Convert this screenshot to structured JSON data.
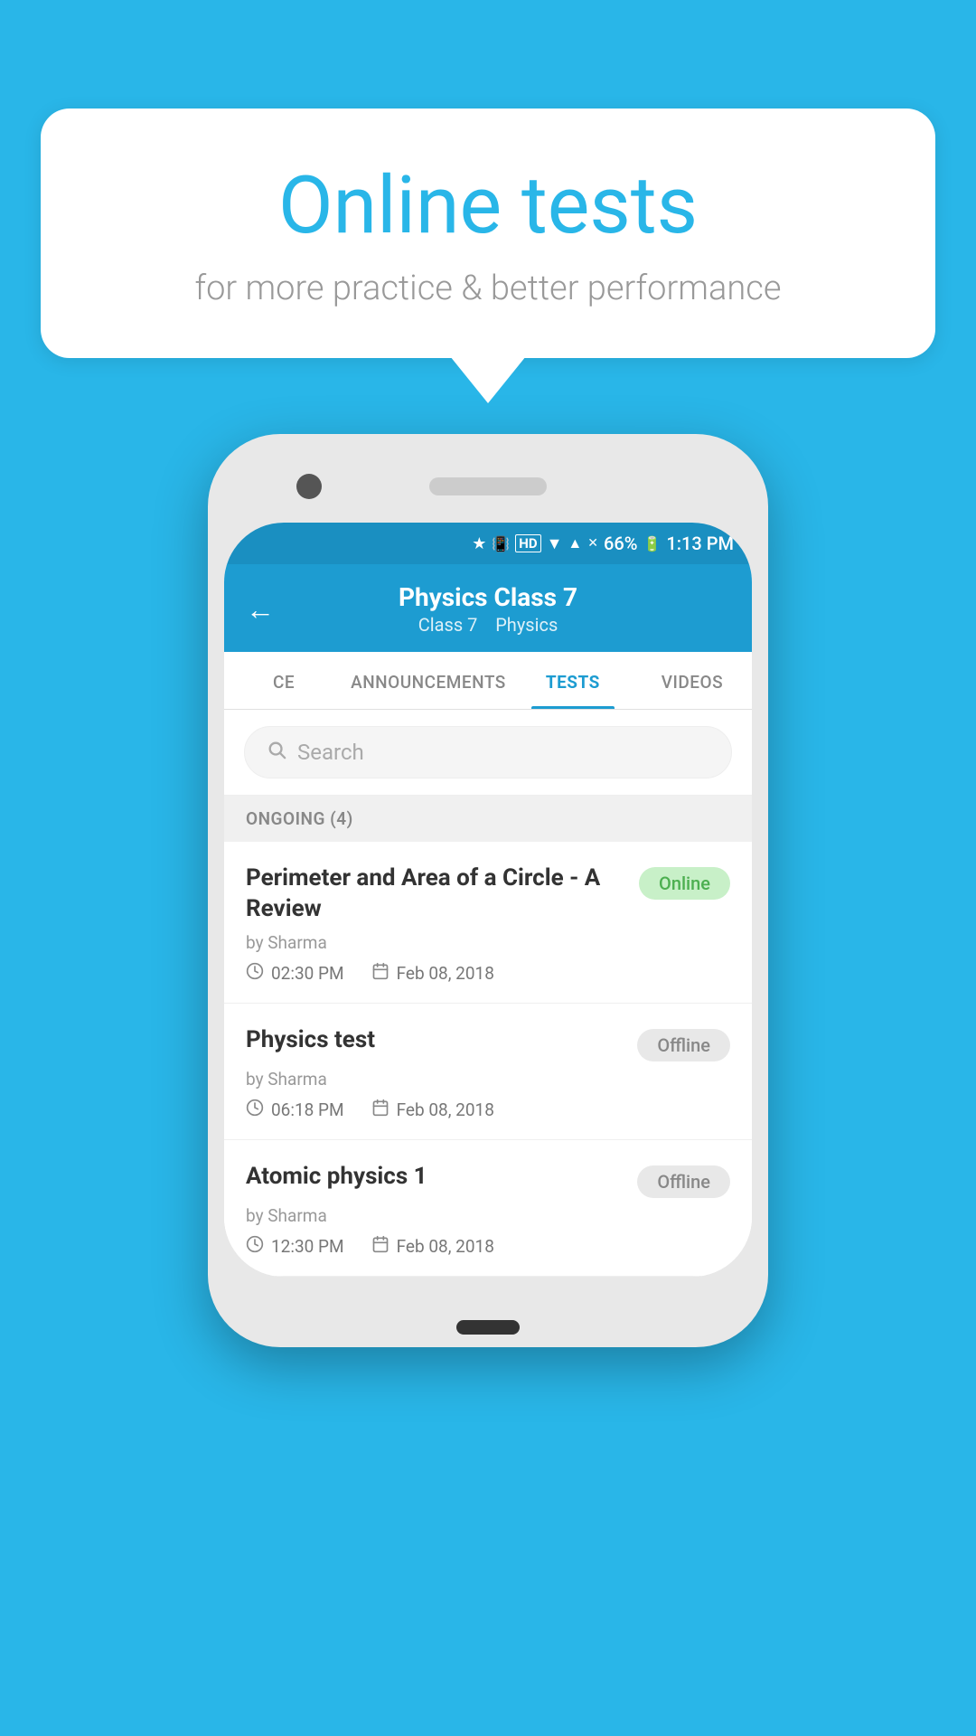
{
  "background_color": "#29b6e8",
  "bubble": {
    "title": "Online tests",
    "subtitle": "for more practice & better performance"
  },
  "status_bar": {
    "time": "1:13 PM",
    "battery": "66%",
    "icons": "* ⬜ HD ▼ ✕ 66%"
  },
  "header": {
    "title": "Physics Class 7",
    "subtitle_class": "Class 7",
    "subtitle_subject": "Physics",
    "back_label": "←"
  },
  "tabs": [
    {
      "id": "ce",
      "label": "CE",
      "active": false
    },
    {
      "id": "announcements",
      "label": "ANNOUNCEMENTS",
      "active": false
    },
    {
      "id": "tests",
      "label": "TESTS",
      "active": true
    },
    {
      "id": "videos",
      "label": "VIDEOS",
      "active": false
    }
  ],
  "search": {
    "placeholder": "Search"
  },
  "sections": [
    {
      "id": "ongoing",
      "label": "ONGOING (4)",
      "tests": [
        {
          "id": "test-1",
          "title": "Perimeter and Area of a Circle - A Review",
          "author": "by Sharma",
          "time": "02:30 PM",
          "date": "Feb 08, 2018",
          "status": "Online",
          "status_type": "online"
        },
        {
          "id": "test-2",
          "title": "Physics test",
          "author": "by Sharma",
          "time": "06:18 PM",
          "date": "Feb 08, 2018",
          "status": "Offline",
          "status_type": "offline"
        },
        {
          "id": "test-3",
          "title": "Atomic physics 1",
          "author": "by Sharma",
          "time": "12:30 PM",
          "date": "Feb 08, 2018",
          "status": "Offline",
          "status_type": "offline"
        }
      ]
    }
  ]
}
